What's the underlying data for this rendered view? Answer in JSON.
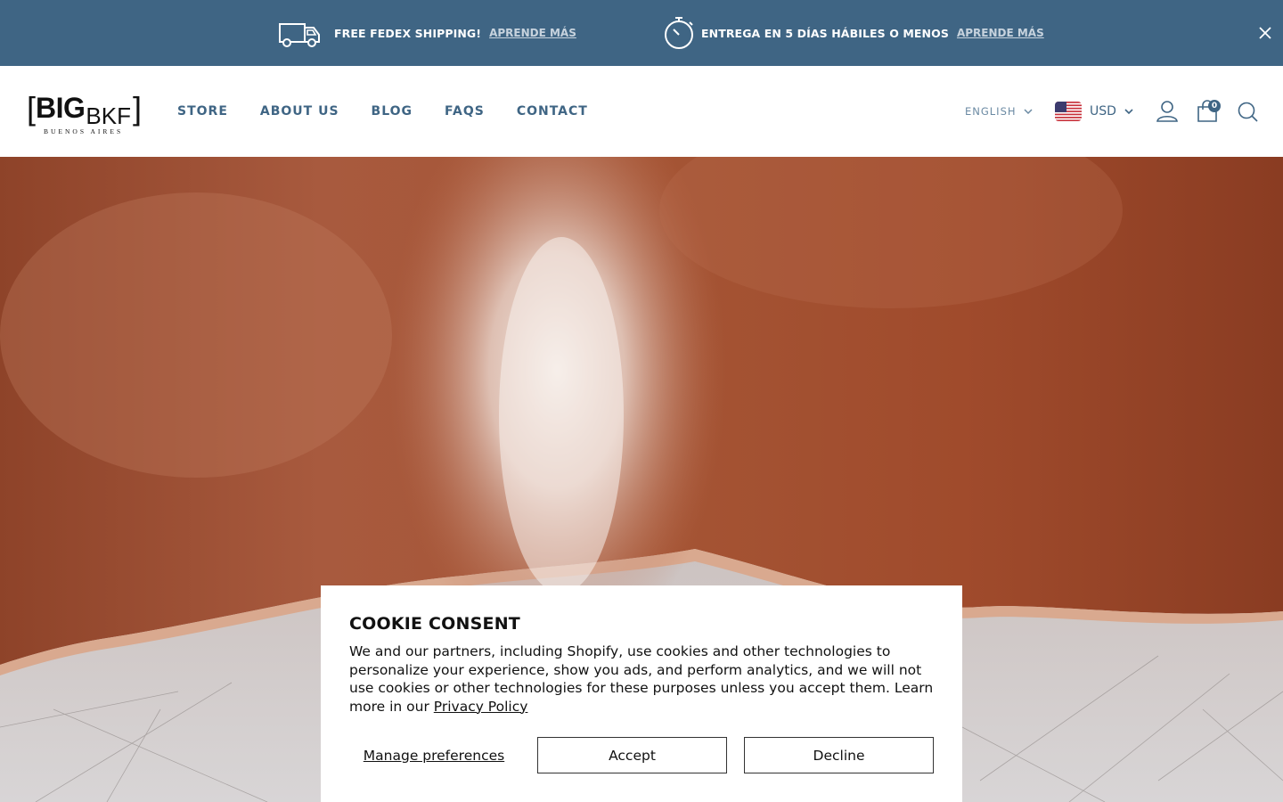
{
  "announcement": {
    "items": [
      {
        "icon": "truck-icon",
        "text": "FREE FEDEX SHIPPING!",
        "link": "APRENDE MÁS"
      },
      {
        "icon": "stopwatch-icon",
        "text": "ENTREGA EN 5 DÍAS HÁBILES O MENOS",
        "link": "APRENDE MÁS"
      }
    ],
    "close_icon": "close-icon"
  },
  "header": {
    "logo": {
      "main": "BIG",
      "secondary": "BKF",
      "sub": "BUENOS AIRES"
    },
    "nav": [
      "STORE",
      "ABOUT US",
      "BLOG",
      "FAQS",
      "CONTACT"
    ],
    "language": "ENGLISH",
    "currency": {
      "flag": "us-flag-icon",
      "label": "USD"
    },
    "cart_count": "0",
    "icons": [
      "user-icon",
      "cart-icon",
      "search-icon"
    ]
  },
  "cookie": {
    "title": "COOKIE CONSENT",
    "body": "We and our partners, including Shopify, use cookies and other technologies to personalize your experience, show you ads, and perform analytics, and we will not use cookies or other technologies for these purposes unless you accept them. Learn more in our",
    "privacy_link": "Privacy Policy",
    "manage": "Manage preferences",
    "accept": "Accept",
    "decline": "Decline"
  },
  "colors": {
    "brand_blue": "#3f6584",
    "leather": "#9c4a2e"
  }
}
